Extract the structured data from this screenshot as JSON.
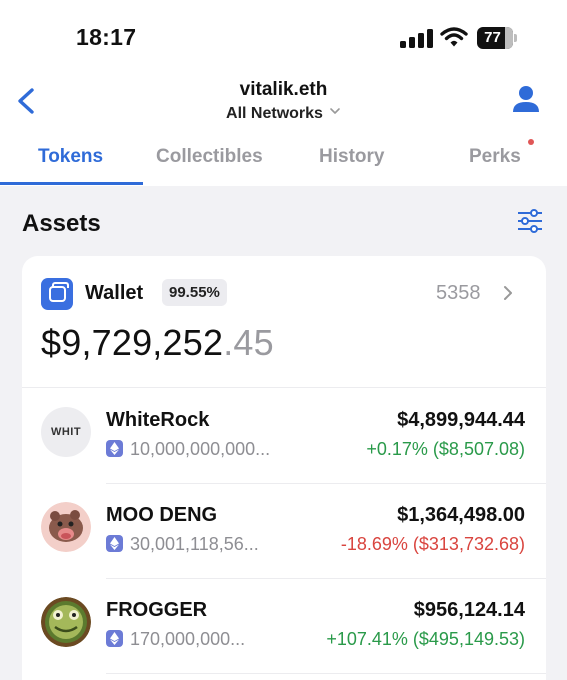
{
  "status_bar": {
    "time": "18:17",
    "battery": "77"
  },
  "nav": {
    "title": "vitalik.eth",
    "network": "All Networks"
  },
  "tabs": [
    {
      "label": "Tokens",
      "active": true
    },
    {
      "label": "Collectibles",
      "active": false
    },
    {
      "label": "History",
      "active": false
    },
    {
      "label": "Perks",
      "active": false,
      "has_notification_dot": true
    }
  ],
  "assets": {
    "title": "Assets",
    "wallet": {
      "label": "Wallet",
      "percent": "99.55%",
      "count": "5358",
      "balance_main": "$9,729,252",
      "balance_cents": ".45"
    },
    "tokens": [
      {
        "icon": "whit-token-icon",
        "icon_text": "WHIT",
        "name": "WhiteRock",
        "amount": "10,000,000,000...",
        "value": "$4,899,944.44",
        "change": "+0.17% ($8,507.08)",
        "direction": "up"
      },
      {
        "icon": "moo-deng-token-icon",
        "name": "MOO DENG",
        "amount": "30,001,118,56...",
        "value": "$1,364,498.00",
        "change": "-18.69% ($313,732.68)",
        "direction": "down"
      },
      {
        "icon": "frogger-token-icon",
        "name": "FROGGER",
        "amount": "170,000,000...",
        "value": "$956,124.14",
        "change": "+107.41% ($495,149.53)",
        "direction": "up"
      }
    ]
  },
  "colors": {
    "accent": "#2f6bd8",
    "positive": "#2a9a4a",
    "negative": "#d9453f",
    "muted": "#9a9a9f",
    "background": "#f2f2f5"
  }
}
